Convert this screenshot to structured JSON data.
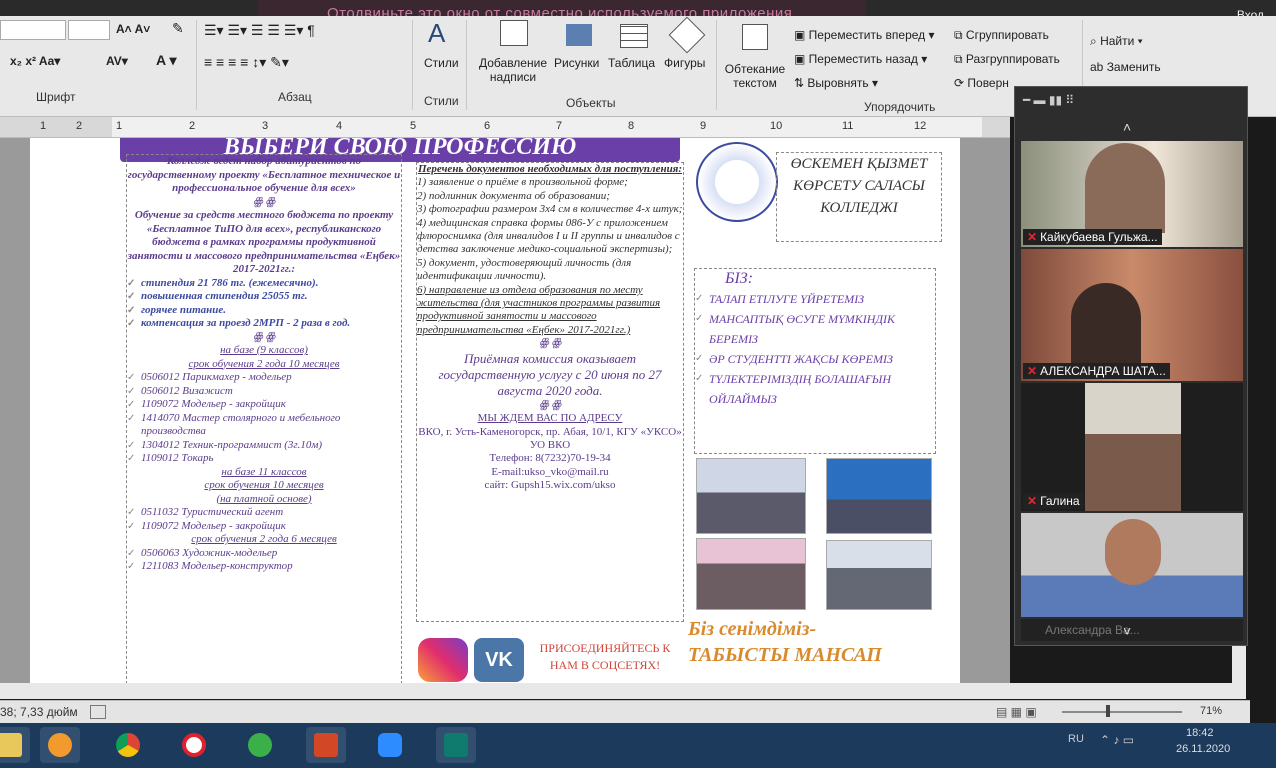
{
  "share_warning": "Отодвиньте это окно от совместно используемого приложения.",
  "login_label": "Вход",
  "ribbon": {
    "font_group": "Шрифт",
    "paragraph_group": "Абзац",
    "styles_group": "Стили",
    "objects_group": "Объекты",
    "arrange_group": "Упорядочить",
    "styles_btn": "Стили",
    "add_caption_btn": "Добавление надписи",
    "pictures_btn": "Рисунки",
    "table_btn": "Таблица",
    "shapes_btn": "Фигуры",
    "wrap_text_btn": "Обтекание текстом",
    "bring_forward": "Переместить вперед",
    "send_backward": "Переместить назад",
    "align": "Выровнять",
    "group": "Сгруппировать",
    "ungroup": "Разгруппировать",
    "rotate": "Поверн",
    "find": "Найти",
    "replace": "Заменить"
  },
  "ruler_ticks": [
    "1",
    "2",
    "3",
    "4",
    "5",
    "6",
    "7",
    "8",
    "9",
    "10",
    "11",
    "12"
  ],
  "document": {
    "banner": "ВЫБЕРИ СВОЮ ПРОФЕССИЮ",
    "col1": {
      "intro": "Колледж ведет набор абитуриентов по государственному проекту «Бесплатное техническое и профессиональное обучение для всех»",
      "ornament": "ꙮ ꙮ",
      "funding": "Обучение за средств местного бюджета по проекту «Бесплатное ТиПО для всех», республиканского бюджета в рамках программы продуктивной занятости и массового предпринимательства «Еңбек» 2017-2021гг.:",
      "benefits": [
        "стипендия 21 786 тг. (ежемесячно).",
        "повышенная стипендия 25055 тг.",
        "горячее питание.",
        "компенсация за проезд 2МРП - 2 раза в год."
      ],
      "base9": "на базе (9 классов)",
      "term9": "срок обучения 2 года 10 месяцев",
      "prof9": [
        "0506012 Парикмахер - модельер",
        "0506012 Визажист",
        "1109072 Модельер - закройщик",
        "1414070 Мастер столярного и мебельного производства",
        "1304012 Техник-программист (3г.10м)",
        "1109012 Токарь"
      ],
      "base11": "на базе 11 классов",
      "term11": "срок обучения 10 месяцев",
      "paid": "(на платной основе)",
      "prof11": [
        "0511032 Туристический агент",
        "1109072 Модельер - закройщик"
      ],
      "term11b": "срок обучения 2 года 6 месяцев",
      "prof11b": [
        "0506063 Художник-модельер",
        "1211083 Модельер-конструктор"
      ]
    },
    "col2": {
      "docs_title": "Перечень документов необходимых для поступления:",
      "docs": [
        "1) заявление о приёме в произвольной форме;",
        "2) подлинник документа об образовании;",
        "3) фотографии размером 3х4 см в количестве 4-х штук;",
        "4) медицинская справка формы 086-У с приложением флюроснимка (для инвалидов I и II группы и инвалидов с детства заключение медико-социальной экспертизы);",
        "5) документ, удостоверяющий личность (для идентификации личности).",
        "6) направление из отдела образования по месту жительства (для участников программы развития продуктивной занятости и массового предпринимательства «Еңбек» 2017-2021гг.)"
      ],
      "commission": "Приёмная комиссия оказывает государственную услугу с 20 июня по 27 августа 2020 года.",
      "wait": "МЫ ЖДЕМ ВАС ПО АДРЕСУ",
      "address": "ВКО, г. Усть-Каменогорск, пр. Абая, 10/1, КГУ «УКСО» УО ВКО",
      "phone": "Телефон: 8(7232)70-19-34",
      "email": "E-mail:ukso_vko@mail.ru",
      "site": "сайт: Gupsh15.wix.com/ukso",
      "social": "ПРИСОЕДИНЯЙТЕСЬ К НАМ В СОЦСЕТЯХ!"
    },
    "col3": {
      "college": "ӨСКЕМЕН ҚЫЗМЕТ КӨРСЕТУ САЛАСЫ КОЛЛЕДЖІ",
      "biz": "БІЗ:",
      "items": [
        "ТАЛАП ЕТІЛУГЕ ҮЙРЕТЕМІЗ",
        "МАНСАПТЫҚ ӨСУГЕ МҮМКІНДІК БЕРЕМІЗ",
        "ӘР СТУДЕНТТІ ЖАҚСЫ КӨРЕМІЗ",
        "ТҮЛЕКТЕРІМІЗДІҢ БОЛАШАҒЫН ОЙЛАЙМЫЗ"
      ],
      "motto1": "Біз сенімдіміз-",
      "motto2": "ТАБЫСТЫ МАНСАП"
    }
  },
  "participants": [
    {
      "name": "Кайкубаева Гульжа..."
    },
    {
      "name": "АЛЕКСАНДРА ШАТА..."
    },
    {
      "name": "Галина"
    },
    {
      "name": "Александра Ва..."
    }
  ],
  "status": {
    "position": "38; 7,33 дюйм",
    "zoom": "71%"
  },
  "taskbar": {
    "lang": "RU",
    "time": "18:42",
    "date": "26.11.2020"
  }
}
